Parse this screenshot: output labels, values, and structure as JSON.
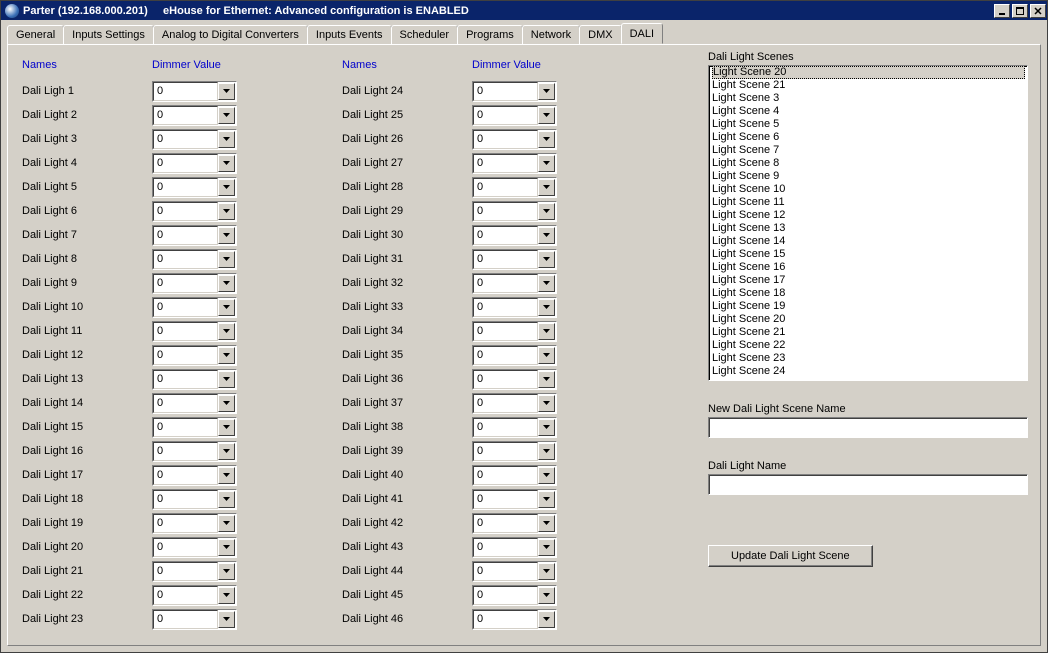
{
  "window": {
    "title": "Parter (192.168.000.201)     eHouse for Ethernet: Advanced configuration is ENABLED"
  },
  "tabs": [
    {
      "label": "General"
    },
    {
      "label": "Inputs Settings"
    },
    {
      "label": "Analog to Digital Converters"
    },
    {
      "label": "Inputs Events"
    },
    {
      "label": "Scheduler"
    },
    {
      "label": "Programs"
    },
    {
      "label": "Network"
    },
    {
      "label": "DMX"
    },
    {
      "label": "DALI"
    }
  ],
  "active_tab": 8,
  "headers": {
    "names": "Names",
    "dimmer": "Dimmer Value"
  },
  "col1": [
    {
      "name": "Dali Ligh 1",
      "value": "0"
    },
    {
      "name": "Dali Light 2",
      "value": "0"
    },
    {
      "name": "Dali Light 3",
      "value": "0"
    },
    {
      "name": "Dali Light 4",
      "value": "0"
    },
    {
      "name": "Dali Light 5",
      "value": "0"
    },
    {
      "name": "Dali Light 6",
      "value": "0"
    },
    {
      "name": "Dali Light 7",
      "value": "0"
    },
    {
      "name": "Dali Light 8",
      "value": "0"
    },
    {
      "name": "Dali Light 9",
      "value": "0"
    },
    {
      "name": "Dali Light 10",
      "value": "0"
    },
    {
      "name": "Dali Light 11",
      "value": "0"
    },
    {
      "name": "Dali Light 12",
      "value": "0"
    },
    {
      "name": "Dali Light 13",
      "value": "0"
    },
    {
      "name": "Dali Light 14",
      "value": "0"
    },
    {
      "name": "Dali Light 15",
      "value": "0"
    },
    {
      "name": "Dali Light 16",
      "value": "0"
    },
    {
      "name": "Dali Light 17",
      "value": "0"
    },
    {
      "name": "Dali Light 18",
      "value": "0"
    },
    {
      "name": "Dali Light 19",
      "value": "0"
    },
    {
      "name": "Dali Light 20",
      "value": "0"
    },
    {
      "name": "Dali Light 21",
      "value": "0"
    },
    {
      "name": "Dali Light 22",
      "value": "0"
    },
    {
      "name": "Dali Light 23",
      "value": "0"
    }
  ],
  "col2": [
    {
      "name": "Dali Light 24",
      "value": "0"
    },
    {
      "name": "Dali Light 25",
      "value": "0"
    },
    {
      "name": "Dali Light 26",
      "value": "0"
    },
    {
      "name": "Dali Light 27",
      "value": "0"
    },
    {
      "name": "Dali Light 28",
      "value": "0"
    },
    {
      "name": "Dali Light 29",
      "value": "0"
    },
    {
      "name": "Dali Light 30",
      "value": "0"
    },
    {
      "name": "Dali Light 31",
      "value": "0"
    },
    {
      "name": "Dali Light 32",
      "value": "0"
    },
    {
      "name": "Dali Light 33",
      "value": "0"
    },
    {
      "name": "Dali Light 34",
      "value": "0"
    },
    {
      "name": "Dali Light 35",
      "value": "0"
    },
    {
      "name": "Dali Light 36",
      "value": "0"
    },
    {
      "name": "Dali Light 37",
      "value": "0"
    },
    {
      "name": "Dali Light 38",
      "value": "0"
    },
    {
      "name": "Dali Light 39",
      "value": "0"
    },
    {
      "name": "Dali Light 40",
      "value": "0"
    },
    {
      "name": "Dali Light 41",
      "value": "0"
    },
    {
      "name": "Dali Light 42",
      "value": "0"
    },
    {
      "name": "Dali Light 43",
      "value": "0"
    },
    {
      "name": "Dali Light 44",
      "value": "0"
    },
    {
      "name": "Dali Light 45",
      "value": "0"
    },
    {
      "name": "Dali Light 46",
      "value": "0"
    }
  ],
  "right": {
    "scenes_label": "Dali Light Scenes",
    "scenes_selected": 0,
    "scenes": [
      "Light Scene 20",
      "Light Scene 21",
      "Light Scene 3",
      "Light Scene 4",
      "Light Scene 5",
      "Light Scene 6",
      "Light Scene 7",
      "Light Scene 8",
      "Light Scene 9",
      "Light Scene 10",
      "Light Scene 11",
      "Light Scene 12",
      "Light Scene 13",
      "Light Scene 14",
      "Light Scene 15",
      "Light Scene 16",
      "Light Scene 17",
      "Light Scene 18",
      "Light Scene 19",
      "Light Scene 20",
      "Light Scene 21",
      "Light Scene 22",
      "Light Scene 23",
      "Light Scene 24"
    ],
    "new_scene_label": "New Dali Light Scene Name",
    "new_scene_value": "",
    "light_name_label": "Dali Light Name",
    "light_name_value": "",
    "update_btn": "Update Dali Light Scene"
  }
}
